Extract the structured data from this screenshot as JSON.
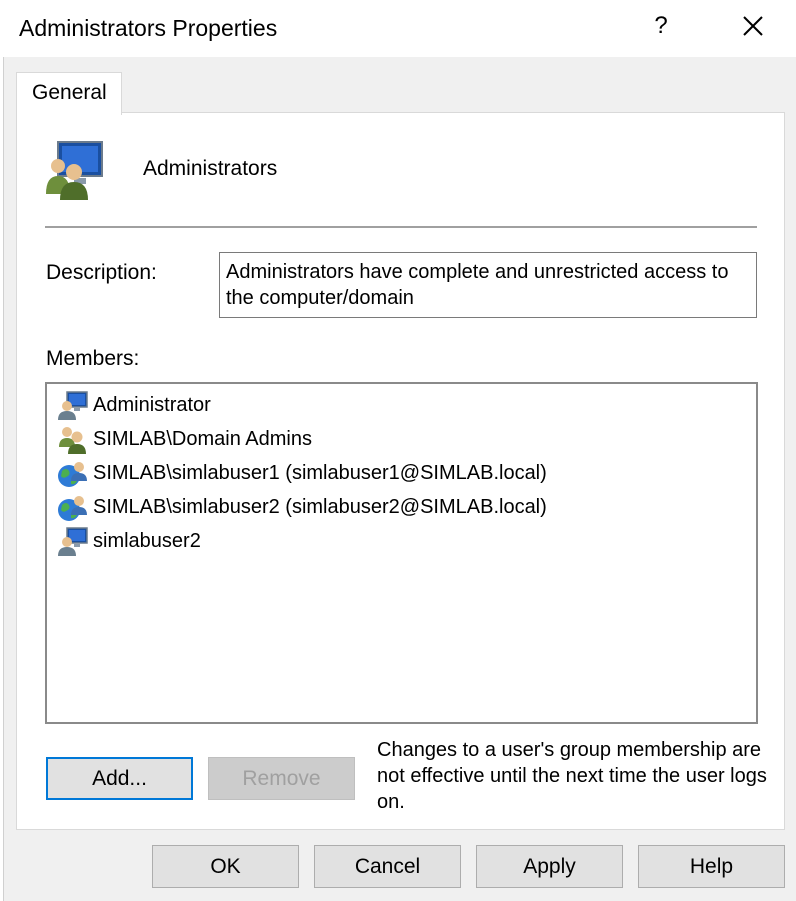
{
  "window": {
    "title": "Administrators Properties",
    "help_glyph": "?",
    "close_icon": "close-icon"
  },
  "tabs": [
    {
      "label": "General"
    }
  ],
  "group": {
    "icon": "user-group-icon",
    "name": "Administrators"
  },
  "description": {
    "label": "Description:",
    "value": "Administrators have complete and unrestricted access to the computer/domain"
  },
  "members": {
    "label": "Members:",
    "items": [
      {
        "icon": "local-user-icon",
        "name": "Administrator"
      },
      {
        "icon": "group-icon",
        "name": "SIMLAB\\Domain Admins"
      },
      {
        "icon": "domain-user-icon",
        "name": "SIMLAB\\simlabuser1 (simlabuser1@SIMLAB.local)"
      },
      {
        "icon": "domain-user-icon",
        "name": "SIMLAB\\simlabuser2 (simlabuser2@SIMLAB.local)"
      },
      {
        "icon": "local-user-icon",
        "name": "simlabuser2"
      }
    ]
  },
  "buttons": {
    "add": "Add...",
    "remove": "Remove",
    "ok": "OK",
    "cancel": "Cancel",
    "apply": "Apply",
    "help": "Help"
  },
  "note": "Changes to a user's group membership are not effective until the next time the user logs on.",
  "colors": {
    "focus_border": "#0078d7",
    "disabled_text": "#a0a0a0"
  }
}
